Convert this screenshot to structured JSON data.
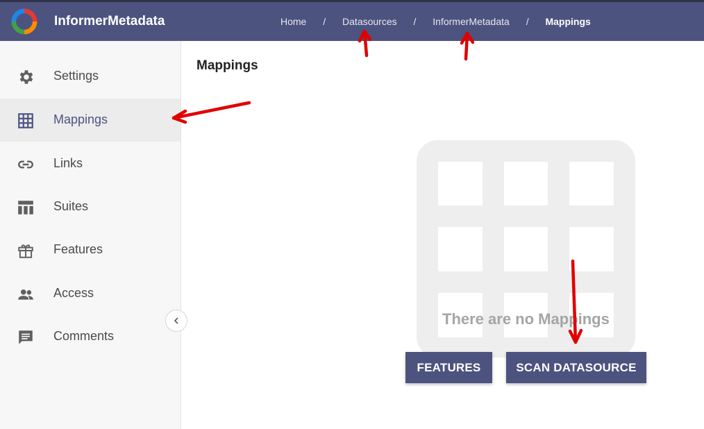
{
  "header": {
    "app_title": "InformerMetadata",
    "logo_icon": "app-logo-icon",
    "breadcrumbs": [
      {
        "label": "Home"
      },
      {
        "label": "Datasources"
      },
      {
        "label": "InformerMetadata"
      },
      {
        "label": "Mappings"
      }
    ],
    "separator": "/"
  },
  "sidebar": {
    "active": "Mappings",
    "items": [
      {
        "label": "Settings",
        "icon": "gear-icon"
      },
      {
        "label": "Mappings",
        "icon": "grid-icon"
      },
      {
        "label": "Links",
        "icon": "link-icon"
      },
      {
        "label": "Suites",
        "icon": "table-icon"
      },
      {
        "label": "Features",
        "icon": "gift-icon"
      },
      {
        "label": "Access",
        "icon": "people-icon"
      },
      {
        "label": "Comments",
        "icon": "comment-icon"
      }
    ],
    "collapse_icon": "chevron-left-icon"
  },
  "main": {
    "title": "Mappings",
    "empty_message": "There are no Mappings",
    "empty_icon": "grid-placeholder-icon",
    "buttons": {
      "features": "FEATURES",
      "scan": "SCAN DATASOURCE"
    }
  },
  "colors": {
    "header_bg": "#4d537f",
    "button_bg": "#4d537f",
    "sidebar_bg": "#f7f7f7",
    "annotation_arrow": "#e00000"
  }
}
